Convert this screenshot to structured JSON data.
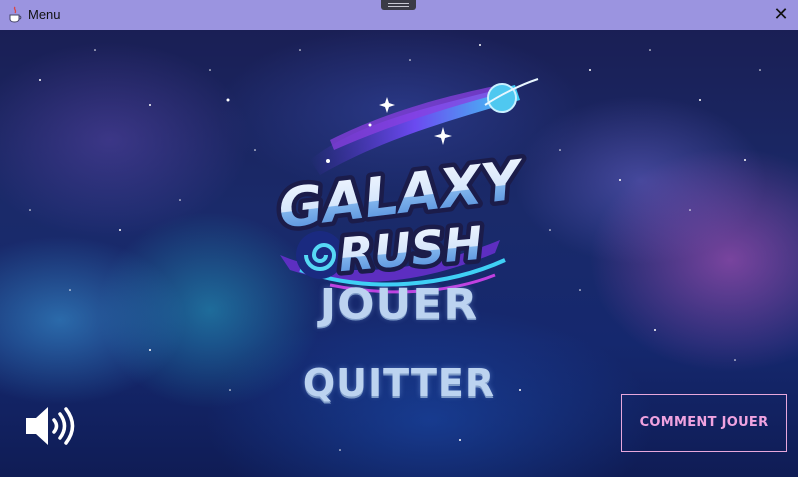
{
  "window": {
    "title": "Menu"
  },
  "logo": {
    "line1": "GALAXY",
    "line2": "RUSH"
  },
  "menu": {
    "play_label": "JOUER",
    "quit_label": "QUITTER"
  },
  "help": {
    "how_to_play_label": "COMMENT JOUER"
  },
  "icons": {
    "app": "java-cup-icon",
    "close": "close-icon",
    "sound": "speaker-icon"
  },
  "colors": {
    "titlebar": "#9b94e0",
    "menu_text": "#bcd3f0",
    "help_text": "#f0a3e0"
  }
}
